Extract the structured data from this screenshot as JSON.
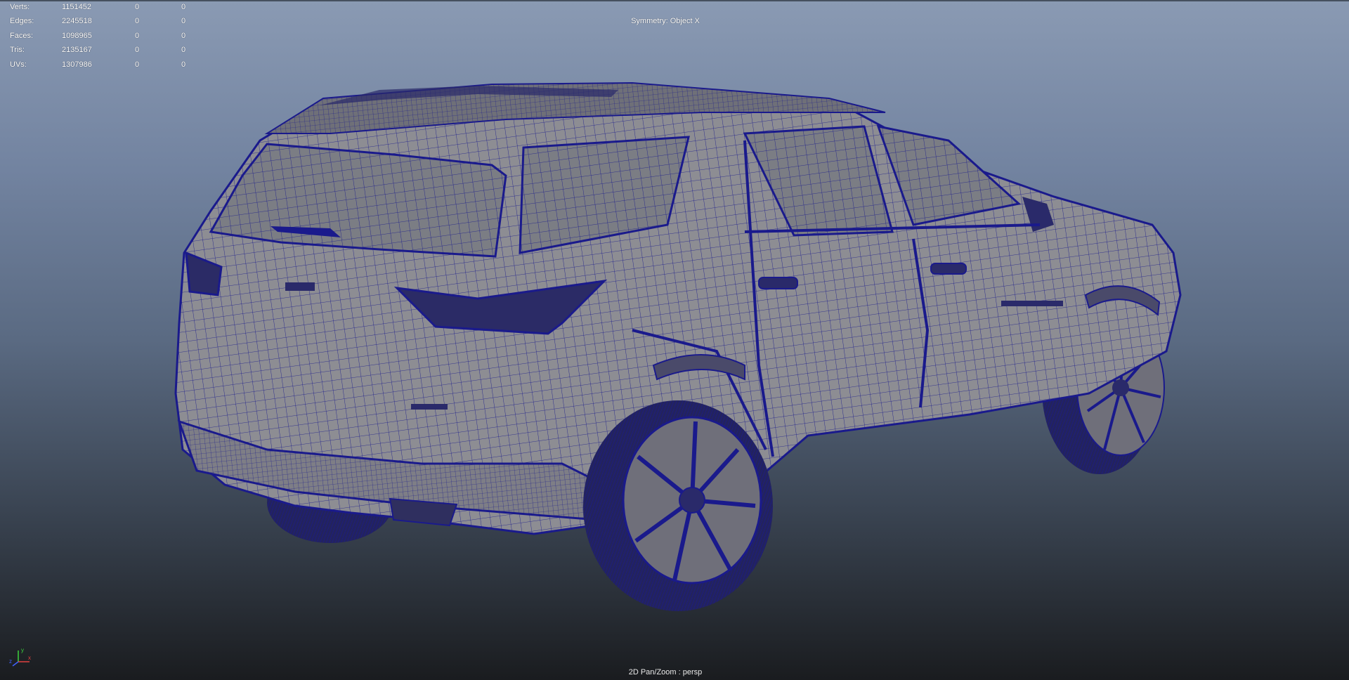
{
  "hud": {
    "rows": [
      {
        "label": "Verts:",
        "v1": "1151452",
        "v2": "0",
        "v3": "0"
      },
      {
        "label": "Edges:",
        "v1": "2245518",
        "v2": "0",
        "v3": "0"
      },
      {
        "label": "Faces:",
        "v1": "1098965",
        "v2": "0",
        "v3": "0"
      },
      {
        "label": "Tris:",
        "v1": "2135167",
        "v2": "0",
        "v3": "0"
      },
      {
        "label": "UVs:",
        "v1": "1307986",
        "v2": "0",
        "v3": "0"
      }
    ]
  },
  "viewport": {
    "symmetry": "Symmetry: Object X",
    "camera": "2D Pan/Zoom : persp"
  },
  "gizmo": {
    "y": "y",
    "x": "x",
    "z": "z"
  },
  "colors": {
    "wire": "#1a1a8c",
    "surface": "#8d8d93",
    "glass": "#7b7d84",
    "tire": "#2a2a6a"
  }
}
